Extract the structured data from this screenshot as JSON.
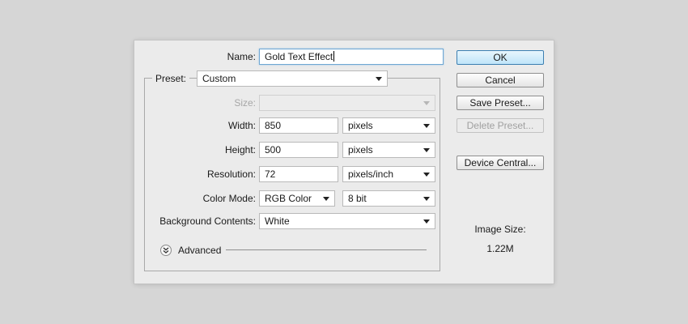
{
  "dialog": {
    "name": {
      "label": "Name:",
      "value": "Gold Text Effect"
    },
    "preset": {
      "label": "Preset:",
      "value": "Custom"
    },
    "size": {
      "label": "Size:",
      "value": ""
    },
    "width": {
      "label": "Width:",
      "value": "850",
      "unit": "pixels"
    },
    "height": {
      "label": "Height:",
      "value": "500",
      "unit": "pixels"
    },
    "resolution": {
      "label": "Resolution:",
      "value": "72",
      "unit": "pixels/inch"
    },
    "color_mode": {
      "label": "Color Mode:",
      "value": "RGB Color",
      "depth": "8 bit"
    },
    "background": {
      "label": "Background Contents:",
      "value": "White"
    },
    "advanced": {
      "label": "Advanced"
    }
  },
  "buttons": {
    "ok": "OK",
    "cancel": "Cancel",
    "save_preset": "Save Preset...",
    "delete_preset": "Delete Preset...",
    "device_central": "Device Central..."
  },
  "image_size": {
    "label": "Image Size:",
    "value": "1.22M"
  },
  "colors": {
    "page_bg": "#d6d6d6",
    "dialog_bg": "#ebebeb",
    "focus_border": "#6fa7d3",
    "default_button": "#bfe4f9"
  },
  "icons": {
    "select_arrow": "chevron-down-icon",
    "advanced_toggle": "expand-chevrons-icon"
  }
}
